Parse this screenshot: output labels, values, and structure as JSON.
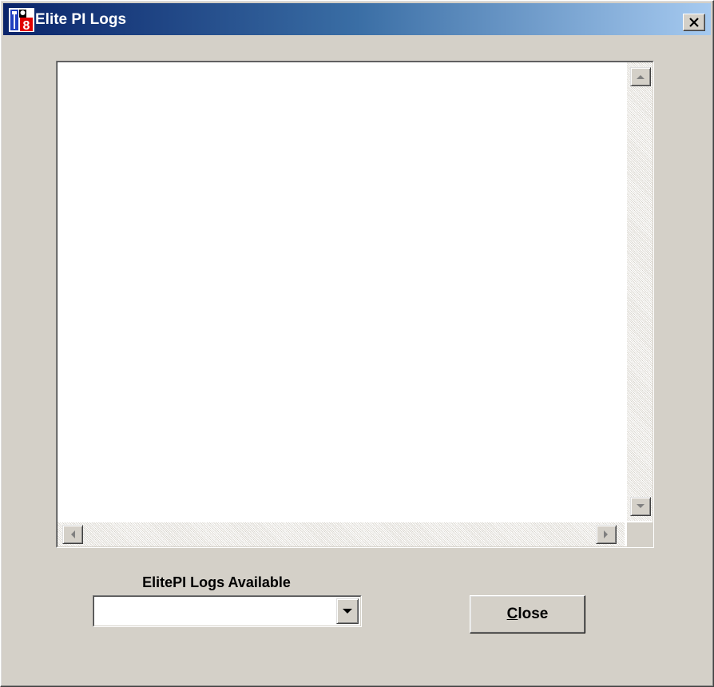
{
  "window": {
    "title": "Elite PI Logs",
    "icon": "app-logo-icon",
    "close_icon": "close-icon"
  },
  "log_view": {
    "content": "",
    "scrollbar_icons": {
      "up": "arrow-up-icon",
      "down": "arrow-down-icon",
      "left": "arrow-left-icon",
      "right": "arrow-right-icon"
    }
  },
  "logs_selector": {
    "label": "ElitePI Logs Available",
    "selected_value": "",
    "dropdown_icon": "chevron-down-icon"
  },
  "actions": {
    "close_label_mnemonic": "C",
    "close_label_rest": "lose"
  },
  "colors": {
    "titlebar_start": "#0a246a",
    "titlebar_end": "#a6caf0",
    "face": "#d4d0c8"
  }
}
